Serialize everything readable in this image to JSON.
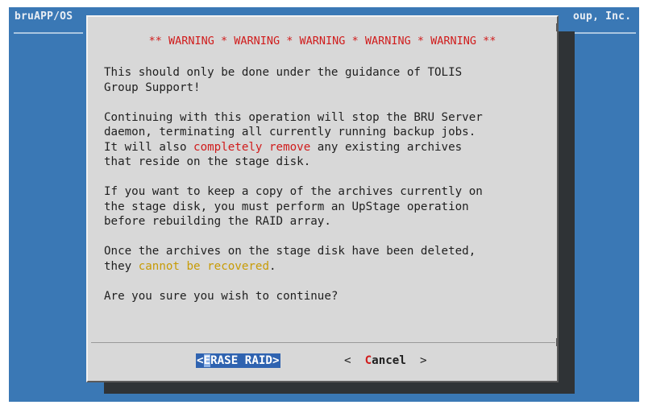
{
  "terminal": {
    "title_left": "bruAPP/OS",
    "title_right": "oup, Inc.",
    "background": "#3a78b5"
  },
  "dialog": {
    "warning_header": "** WARNING * WARNING * WARNING * WARNING * WARNING **",
    "paragraphs": {
      "p1": "This should only be done under the guidance of TOLIS\nGroup Support!",
      "p2_a": "Continuing with this operation will stop the BRU Server\ndaemon, terminating all currently running backup jobs.\nIt will also ",
      "p2_red": "completely remove",
      "p2_b": " any existing archives\nthat reside on the stage disk.",
      "p3": "If you want to keep a copy of the archives currently on\nthe stage disk, you must perform an UpStage operation\nbefore rebuilding the RAID array.",
      "p4_a": "Once the archives on the stage disk have been deleted,\nthey ",
      "p4_yellow": "cannot be recovered",
      "p4_b": ".",
      "p5": "Are you sure you wish to continue?"
    },
    "buttons": {
      "erase_open": "<",
      "erase_hotkey": "E",
      "erase_rest": "RASE RAID>",
      "cancel_open": "<  ",
      "cancel_hotkey": "C",
      "cancel_rest": "ancel",
      "cancel_close": "  >"
    }
  },
  "colors": {
    "warning": "#d01c1c",
    "caution": "#c79b06",
    "selected_button": "#2f63b0",
    "dialog_bg": "#d8d8d8"
  }
}
